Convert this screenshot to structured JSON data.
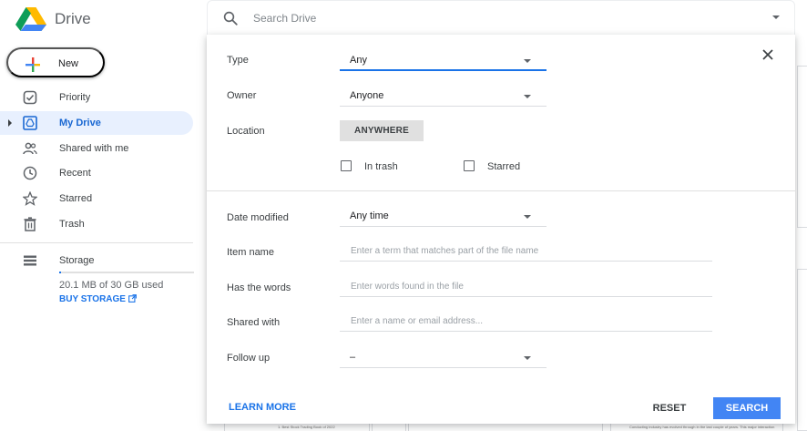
{
  "header": {
    "app_title": "Drive",
    "search_placeholder": "Search Drive"
  },
  "sidebar": {
    "new_label": "New",
    "items": [
      {
        "label": "Priority",
        "icon": "priority-icon"
      },
      {
        "label": "My Drive",
        "icon": "my-drive-icon"
      },
      {
        "label": "Shared with me",
        "icon": "shared-icon"
      },
      {
        "label": "Recent",
        "icon": "clock-icon"
      },
      {
        "label": "Starred",
        "icon": "star-icon"
      },
      {
        "label": "Trash",
        "icon": "trash-icon"
      },
      {
        "label": "Storage",
        "icon": "storage-icon"
      }
    ],
    "storage_used": "20.1 MB of 30 GB used",
    "storage_fraction": 0.0007,
    "buy_storage_label": "BUY STORAGE"
  },
  "background_files": {
    "card_1_text": "1. Best Stock Trading Book of 2022",
    "card_2_text": "Conducting industry has evolved through in the last couple of years. This major interaction"
  },
  "advanced_search": {
    "type_label": "Type",
    "type_value": "Any",
    "owner_label": "Owner",
    "owner_value": "Anyone",
    "location_label": "Location",
    "location_value": "ANYWHERE",
    "in_trash_label": "In trash",
    "starred_label": "Starred",
    "date_modified_label": "Date modified",
    "date_modified_value": "Any time",
    "item_name_label": "Item name",
    "item_name_placeholder": "Enter a term that matches part of the file name",
    "has_words_label": "Has the words",
    "has_words_placeholder": "Enter words found in the file",
    "shared_with_label": "Shared with",
    "shared_with_placeholder": "Enter a name or email address...",
    "follow_up_label": "Follow up",
    "follow_up_value": "–",
    "learn_more_label": "LEARN MORE",
    "reset_label": "RESET",
    "search_label": "SEARCH"
  },
  "colors": {
    "accent": "#1a73e8",
    "search_button": "#4285f4",
    "active_nav_bg": "#e8f0fe"
  }
}
